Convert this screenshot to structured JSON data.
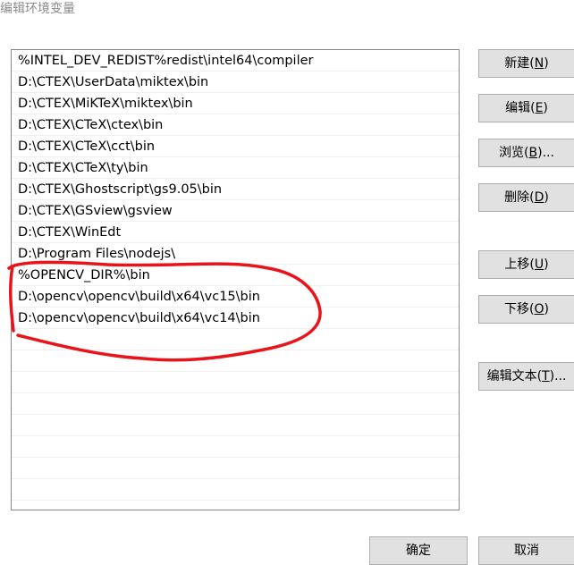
{
  "window": {
    "title": "编辑环境变量"
  },
  "path_entries": [
    "%INTEL_DEV_REDIST%redist\\intel64\\compiler",
    "D:\\CTEX\\UserData\\miktex\\bin",
    "D:\\CTEX\\MiKTeX\\miktex\\bin",
    "D:\\CTEX\\CTeX\\ctex\\bin",
    "D:\\CTEX\\CTeX\\cct\\bin",
    "D:\\CTEX\\CTeX\\ty\\bin",
    "D:\\CTEX\\Ghostscript\\gs9.05\\bin",
    "D:\\CTEX\\GSview\\gsview",
    "D:\\CTEX\\WinEdt",
    "D:\\Program Files\\nodejs\\",
    "%OPENCV_DIR%\\bin",
    "D:\\opencv\\opencv\\build\\x64\\vc15\\bin",
    "D:\\opencv\\opencv\\build\\x64\\vc14\\bin"
  ],
  "buttons": {
    "new": {
      "label": "新建(",
      "key": "N",
      "end": ")"
    },
    "edit": {
      "label": "编辑(",
      "key": "E",
      "end": ")"
    },
    "browse": {
      "label": "浏览(",
      "key": "B",
      "end": ")..."
    },
    "delete": {
      "label": "删除(",
      "key": "D",
      "end": ")"
    },
    "move_up": {
      "label": "上移(",
      "key": "U",
      "end": ")"
    },
    "move_down": {
      "label": "下移(",
      "key": "O",
      "end": ")"
    },
    "edit_text": {
      "label": "编辑文本(",
      "key": "T",
      "end": ")..."
    },
    "ok": {
      "label": "确定"
    },
    "cancel": {
      "label": "取消"
    }
  },
  "annotation": {
    "color": "#e8141a"
  }
}
